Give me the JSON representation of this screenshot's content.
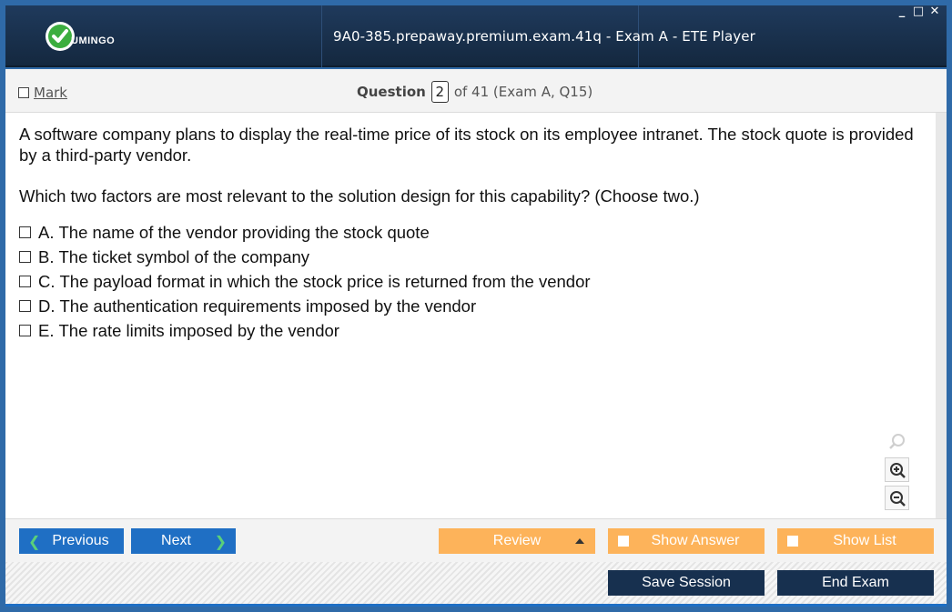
{
  "window": {
    "title": "9A0-385.prepaway.premium.exam.41q - Exam A - ETE Player",
    "logo_text": "UMINGO",
    "controls": [
      "minimize-icon",
      "maximize-icon",
      "close-icon"
    ],
    "control_glyphs": [
      "_",
      "□",
      "✕"
    ]
  },
  "header": {
    "mark_label": "Mark",
    "question_label": "Question",
    "question_number": "2",
    "question_suffix": "of 41 (Exam A, Q15)"
  },
  "question": {
    "stem": "A software company plans to display the real-time price of its stock on its employee intranet. The stock quote is provided by a third-party vendor.",
    "prompt": "Which two factors are most relevant to the solution design for this capability? (Choose two.)",
    "options": [
      {
        "letter": "A.",
        "text": "The name of the vendor providing the stock quote"
      },
      {
        "letter": "B.",
        "text": "The ticket symbol of the company"
      },
      {
        "letter": "C.",
        "text": "The payload format in which the stock price is returned from the vendor"
      },
      {
        "letter": "D.",
        "text": "The authentication requirements imposed by the vendor"
      },
      {
        "letter": "E.",
        "text": "The rate limits imposed by the vendor"
      }
    ]
  },
  "nav": {
    "previous": "Previous",
    "next": "Next",
    "review": "Review",
    "show_answer": "Show Answer",
    "show_list": "Show List",
    "save_session": "Save Session",
    "end_exam": "End Exam"
  },
  "colors": {
    "title_bar": "#1a3150",
    "blue_button": "#1f6fc4",
    "orange_button": "#fdb35a",
    "dark_button": "#17304f",
    "logo_green": "#3cae3f"
  }
}
